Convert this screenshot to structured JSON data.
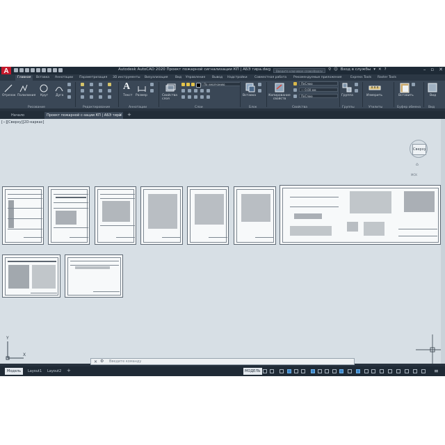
{
  "app": {
    "logo": "A",
    "title": "Autodesk AutoCAD 2020   Проект пожарной сигнализации КП | АБЭ тира.dwg",
    "search_placeholder": "Введите ключевое слово/фразу",
    "sign_in": "Вход в службы",
    "help": "?"
  },
  "ribbon": {
    "tabs": [
      "Главная",
      "Вставка",
      "Аннотации",
      "Параметризация",
      "3D инструменты",
      "Визуализация",
      "Вид",
      "Управление",
      "Вывод",
      "Надстройки",
      "Совместная работа",
      "Рекомендуемые приложения",
      "Express Tools",
      "Raster Tools"
    ],
    "draw_tools": [
      "Отрезок",
      "Полилиния",
      "Круг",
      "Дуга"
    ],
    "annotation_tools": [
      "Текст",
      "Размер"
    ],
    "block_tools": [
      "Вставка"
    ],
    "layer_tools": [
      "Свойства слоя"
    ],
    "layer_name": "По умолчанию",
    "props_tool": "Копирование свойств",
    "props": {
      "color": "ПоСлою",
      "lineweight": "— 0.00 мм",
      "linetype": "ПоСлою"
    },
    "groups_tool": "Группа",
    "utilities_tool": "Измерить",
    "clipboard_tool": "Вставить",
    "view_tool": "Вид",
    "panel_labels": [
      "Рисование",
      "Редактирование",
      "Аннотации",
      "Слои",
      "Блок",
      "Свойства",
      "Группы",
      "Утилиты",
      "Буфер обмена",
      "Вид"
    ]
  },
  "file_tabs": [
    "Начало",
    "Проект пожарной с-зации КП | АБЭ тира"
  ],
  "viewport": {
    "label": "[−][Сверху][2D-каркас]",
    "viewcube_face": "Сверху",
    "wcs": "МСК",
    "ucs_x": "X",
    "ucs_y": "Y"
  },
  "command_line": {
    "placeholder": "Введите команду"
  },
  "status": {
    "layout_tabs": [
      "Модель",
      "Layout1",
      "Layout2"
    ],
    "model_label": "МОДЕЛЬ"
  }
}
